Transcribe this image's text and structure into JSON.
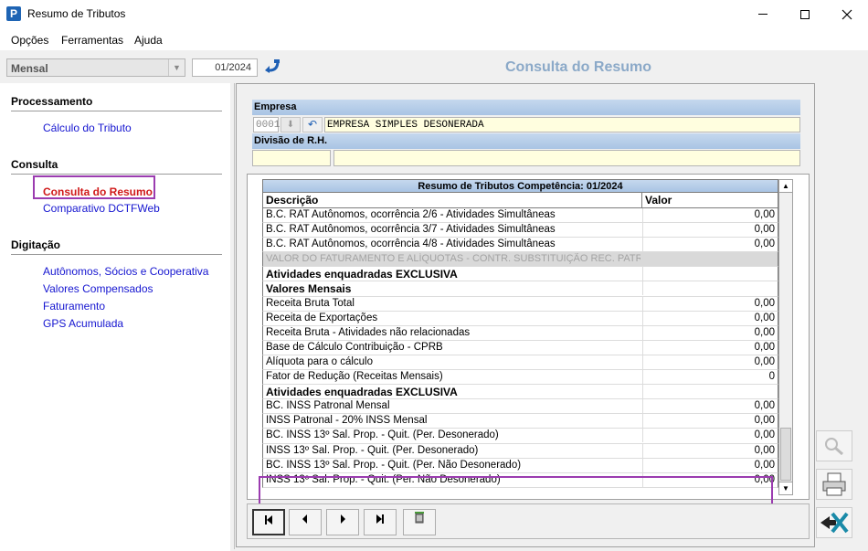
{
  "window": {
    "title": "Resumo de Tributos",
    "app_icon": "P"
  },
  "menu": [
    "Opções",
    "Ferramentas",
    "Ajuda"
  ],
  "toolbar": {
    "period_value": "Mensal",
    "competencia": "01/2024",
    "page_heading": "Consulta do Resumo"
  },
  "sidebar": {
    "sections": [
      {
        "title": "Processamento",
        "items": [
          {
            "label": "Cálculo do Tributo",
            "active": false
          }
        ]
      },
      {
        "title": "Consulta",
        "items": [
          {
            "label": "Consulta do Resumo",
            "active": true
          },
          {
            "label": "Comparativo DCTFWeb",
            "active": false
          }
        ]
      },
      {
        "title": "Digitação",
        "items": [
          {
            "label": "Autônomos, Sócios e Cooperativa",
            "active": false
          },
          {
            "label": "Valores Compensados",
            "active": false
          },
          {
            "label": "Faturamento",
            "active": false
          },
          {
            "label": "GPS Acumulada",
            "active": false
          }
        ]
      }
    ]
  },
  "empresa": {
    "label": "Empresa",
    "code": "0001",
    "name": "EMPRESA SIMPLES DESONERADA",
    "divisao_label": "Divisão de R.H.",
    "divisao_code": "",
    "divisao_name": ""
  },
  "grid": {
    "title": "Resumo de Tributos Competência: 01/2024",
    "col_desc": "Descrição",
    "col_val": "Valor",
    "rows": [
      {
        "desc": "B.C. RAT Autônomos, ocorrência 2/6 - Atividades Simultâneas",
        "value": "0,00",
        "type": "normal"
      },
      {
        "desc": "B.C. RAT Autônomos, ocorrência 3/7 - Atividades Simultâneas",
        "value": "0,00",
        "type": "normal"
      },
      {
        "desc": "B.C. RAT Autônomos, ocorrência 4/8 - Atividades Simultâneas",
        "value": "0,00",
        "type": "normal"
      },
      {
        "desc": "VALOR DO FATURAMENTO E ALÍQUOTAS - CONTR. SUBSTITUIÇÃO REC. PATRONAL",
        "value": "",
        "type": "disabled"
      },
      {
        "desc": "Atividades enquadradas EXCLUSIVA",
        "value": "",
        "type": "section"
      },
      {
        "desc": "Valores Mensais",
        "value": "",
        "type": "section"
      },
      {
        "desc": "Receita Bruta Total",
        "value": "0,00",
        "type": "normal"
      },
      {
        "desc": "Receita de Exportações",
        "value": "0,00",
        "type": "normal"
      },
      {
        "desc": "Receita Bruta - Atividades não relacionadas",
        "value": "0,00",
        "type": "normal"
      },
      {
        "desc": "Base de Cálculo Contribuição - CPRB",
        "value": "0,00",
        "type": "normal"
      },
      {
        "desc": "Alíquota para o cálculo",
        "value": "0,00",
        "type": "normal"
      },
      {
        "desc": "Fator de Redução (Receitas Mensais)",
        "value": "0",
        "type": "normal"
      },
      {
        "desc": "Atividades enquadradas EXCLUSIVA",
        "value": "",
        "type": "section"
      },
      {
        "desc": "BC. INSS Patronal Mensal",
        "value": "0,00",
        "type": "normal"
      },
      {
        "desc": "INSS Patronal - 20% INSS Mensal",
        "value": "0,00",
        "type": "normal"
      },
      {
        "desc": "BC. INSS 13º Sal. Prop. - Quit. (Per. Desonerado)",
        "value": "0,00",
        "type": "normal"
      },
      {
        "desc": "INSS 13º Sal. Prop. - Quit. (Per. Desonerado)",
        "value": "0,00",
        "type": "normal"
      },
      {
        "desc": "BC. INSS 13º Sal. Prop. - Quit. (Per. Não Desonerado)",
        "value": "0,00",
        "type": "normal"
      },
      {
        "desc": "INSS 13º Sal. Prop. - Quit. (Per. Não Desonerado)",
        "value": "0,00",
        "type": "normal"
      }
    ]
  },
  "nav_buttons": [
    "first-record",
    "previous-record",
    "next-record",
    "last-record",
    "delete-record"
  ],
  "side_buttons": [
    "search",
    "print",
    "exit"
  ],
  "colors": {
    "accent_heading": "#8ba9c8",
    "active_link": "#d01a1a",
    "link": "#1515d0",
    "highlight_box": "#9b3cb0"
  }
}
